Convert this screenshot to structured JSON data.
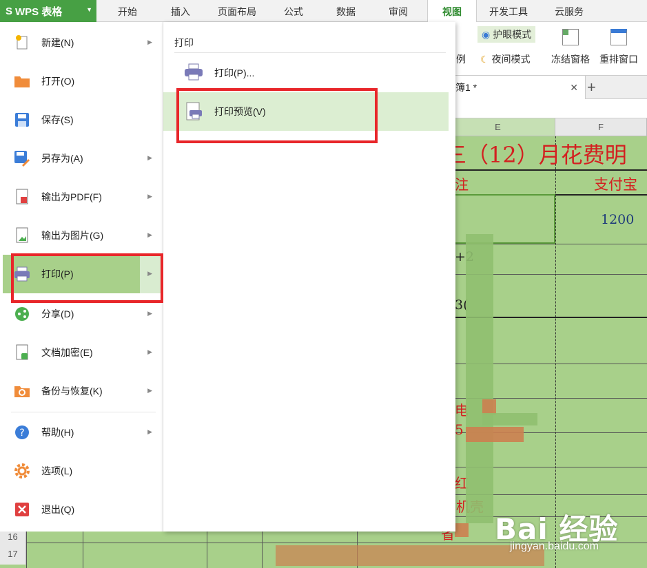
{
  "app": {
    "name": "WPS 表格"
  },
  "tabs": [
    "开始",
    "插入",
    "页面布局",
    "公式",
    "数据",
    "审阅",
    "视图",
    "开发工具",
    "云服务"
  ],
  "active_tab": "视图",
  "ribbon": {
    "eye_mode": "护眼模式",
    "night_mode": "夜间模式",
    "freeze_panes": "冻结窗格",
    "rearrange_window": "重排窗口",
    "partial_label": "例"
  },
  "document_tab": {
    "name": "簿1 *"
  },
  "sheet": {
    "columns": [
      "E",
      "F"
    ],
    "title": "三（12）月花费明",
    "header_e": "注",
    "header_f": "支付宝",
    "value_f": "1200",
    "fragments": [
      "+2",
      "3(",
      "电",
      "5",
      "5",
      "红",
      "机壳",
      "省"
    ],
    "row_numbers": [
      "16",
      "17"
    ]
  },
  "file_menu": {
    "items": [
      {
        "label": "新建(N)",
        "icon": "new-file-icon",
        "submenu": true
      },
      {
        "label": "打开(O)",
        "icon": "open-folder-icon",
        "submenu": false
      },
      {
        "label": "保存(S)",
        "icon": "save-icon",
        "submenu": false
      },
      {
        "label": "另存为(A)",
        "icon": "save-as-icon",
        "submenu": true
      },
      {
        "label": "输出为PDF(F)",
        "icon": "pdf-icon",
        "submenu": true
      },
      {
        "label": "输出为图片(G)",
        "icon": "image-export-icon",
        "submenu": true
      },
      {
        "label": "打印(P)",
        "icon": "print-icon",
        "submenu": true
      },
      {
        "label": "分享(D)",
        "icon": "share-icon",
        "submenu": true
      },
      {
        "label": "文档加密(E)",
        "icon": "lock-document-icon",
        "submenu": true
      },
      {
        "label": "备份与恢复(K)",
        "icon": "backup-icon",
        "submenu": true
      },
      {
        "label": "帮助(H)",
        "icon": "help-icon",
        "submenu": true
      },
      {
        "label": "选项(L)",
        "icon": "gear-icon",
        "submenu": false
      },
      {
        "label": "退出(Q)",
        "icon": "close-icon",
        "submenu": false
      }
    ],
    "active_item": "打印(P)"
  },
  "print_submenu": {
    "title": "打印",
    "items": [
      {
        "label": "打印(P)...",
        "icon": "printer-icon"
      },
      {
        "label": "打印预览(V)",
        "icon": "print-preview-icon"
      }
    ]
  },
  "watermark": {
    "brand": "Bai 经验",
    "url": "jingyan.baidu.com"
  },
  "colors": {
    "green_accent": "#47a044",
    "sheet_bg": "#a8d08a",
    "highlight_red": "#e8262a",
    "title_red": "#d32020"
  }
}
